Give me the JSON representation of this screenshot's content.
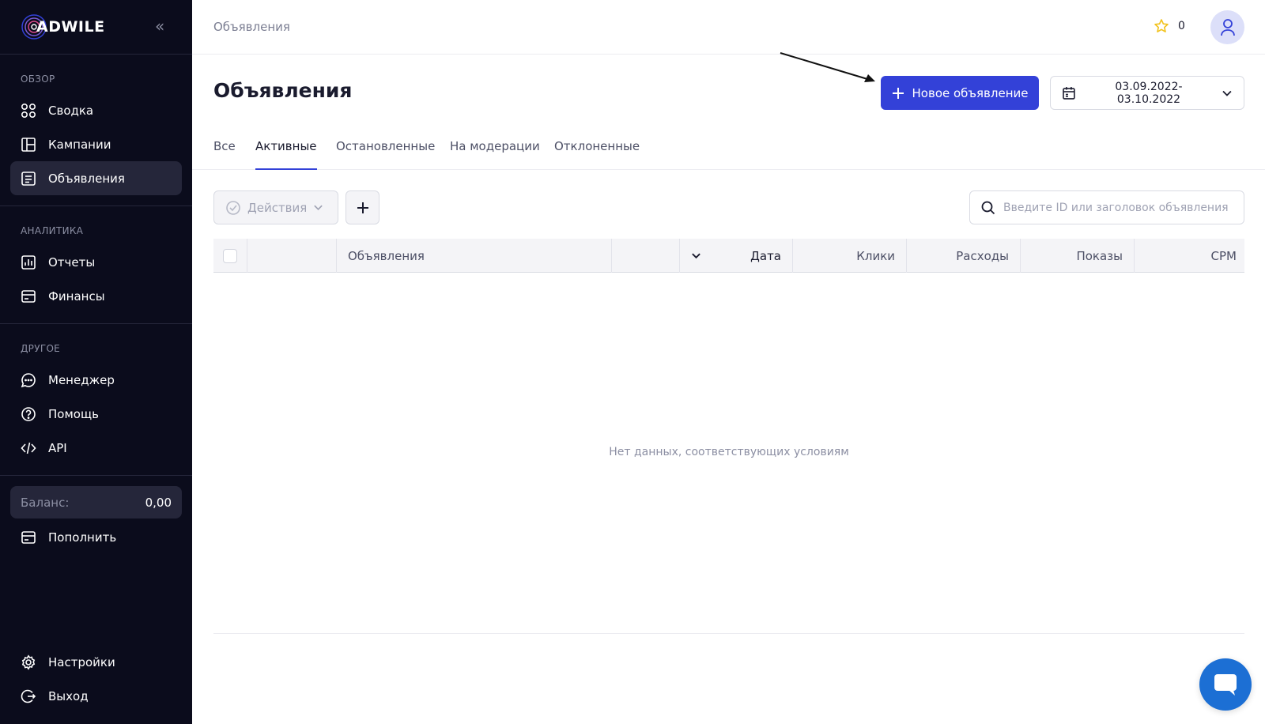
{
  "brand": {
    "name": "ADWILE"
  },
  "sidebar": {
    "overview_title": "ОБЗОР",
    "overview_items": [
      {
        "label": "Сводка",
        "icon": "grid-icon"
      },
      {
        "label": "Кампании",
        "icon": "layout-icon"
      },
      {
        "label": "Объявления",
        "icon": "document-icon",
        "active": true
      }
    ],
    "analytics_title": "АНАЛИТИКА",
    "analytics_items": [
      {
        "label": "Отчеты",
        "icon": "chart-icon"
      },
      {
        "label": "Финансы",
        "icon": "wallet-icon"
      }
    ],
    "other_title": "ДРУГОЕ",
    "other_items": [
      {
        "label": "Менеджер",
        "icon": "chat-bubble-icon"
      },
      {
        "label": "Помощь",
        "icon": "help-icon"
      },
      {
        "label": "API",
        "icon": "code-icon"
      }
    ],
    "balance": {
      "label": "Баланс:",
      "value": "0,00"
    },
    "topup_label": "Пополнить",
    "settings_label": "Настройки",
    "logout_label": "Выход"
  },
  "header": {
    "breadcrumb": "Объявления",
    "stars_count": "0"
  },
  "main": {
    "title": "Объявления",
    "new_button_label": "Новое объявление",
    "date_range": "03.09.2022-03.10.2022",
    "tabs": [
      {
        "label": "Все"
      },
      {
        "label": "Активные",
        "active": true
      },
      {
        "label": "Остановленные"
      },
      {
        "label": "На модерации"
      },
      {
        "label": "Отклоненные"
      }
    ],
    "actions_label": "Действия",
    "search_placeholder": "Введите ID или заголовок объявления",
    "table": {
      "columns": [
        "Объявления",
        "Дата",
        "Клики",
        "Расходы",
        "Показы",
        "CPM"
      ],
      "empty_message": "Нет данных, соответствующих условиям"
    }
  },
  "colors": {
    "sidebar_bg": "#0b0c1c",
    "accent": "#3341d8",
    "chat": "#1c6fd4",
    "star": "#f2c21b"
  }
}
